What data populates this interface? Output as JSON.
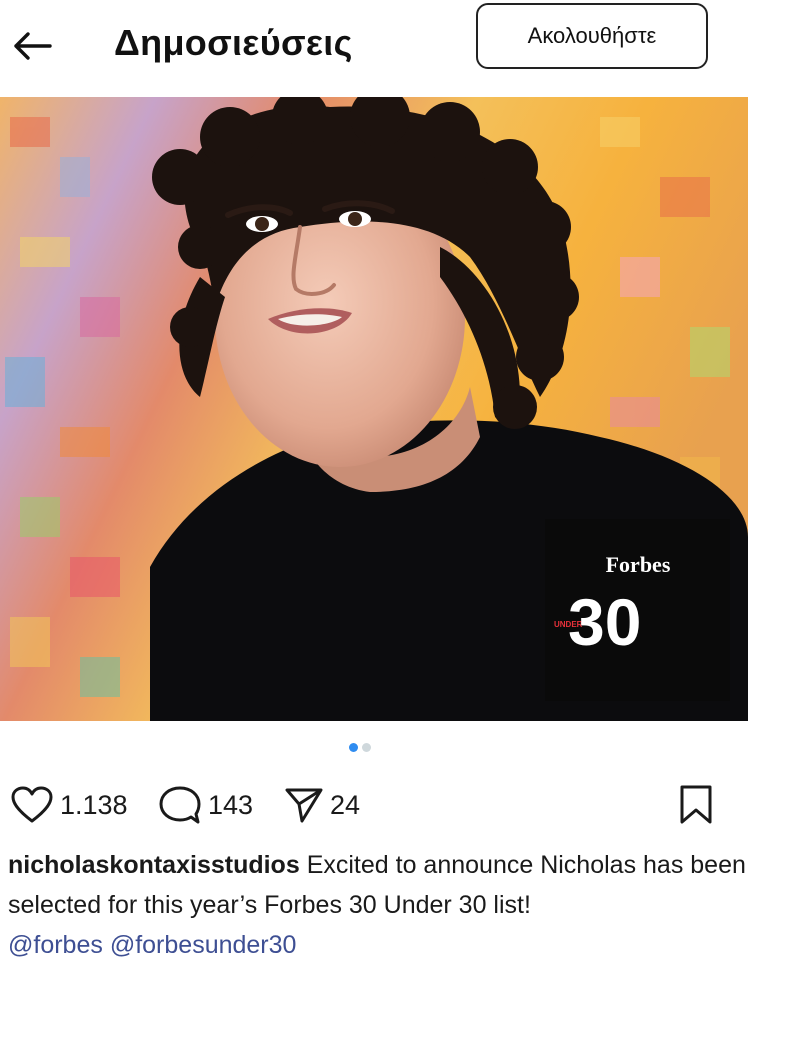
{
  "header": {
    "back_icon": "arrow-left-icon",
    "title": "Δημοσιεύσεις",
    "follow_label": "Ακολουθήστε"
  },
  "image": {
    "badge_brand": "Forbes",
    "badge_under": "UNDER",
    "badge_number": "30"
  },
  "carousel": {
    "count": 2,
    "active_index": 0,
    "active_color": "#2f8cf0"
  },
  "actions": {
    "likes": "1.138",
    "comments": "143",
    "shares": "24",
    "icons": [
      "heart-icon",
      "comment-icon",
      "send-icon",
      "bookmark-icon"
    ]
  },
  "caption": {
    "username": "nicholaskontaxisstudios",
    "text": "Excited to announce Nicholas has been selected for this year’s Forbes 30 Under 30 list!",
    "mention_1": "@forbes",
    "mention_2": "@forbesunder30",
    "mention_color": "#3e4f93"
  }
}
